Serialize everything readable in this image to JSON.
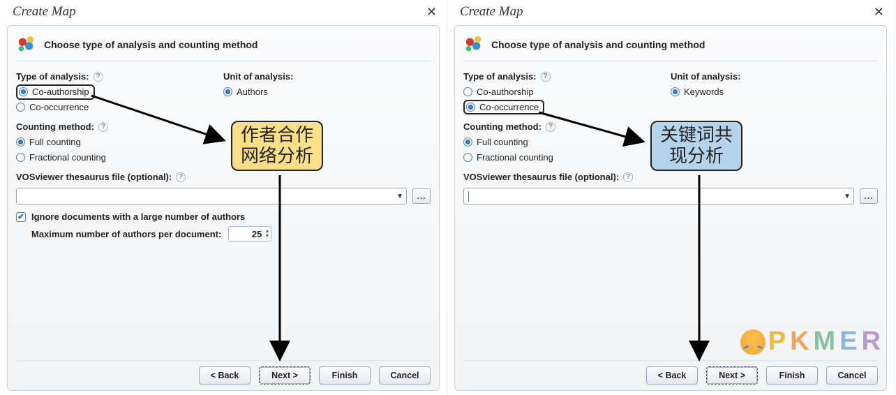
{
  "panels": [
    {
      "title": "Create Map",
      "heading": "Choose type of analysis and counting method",
      "labels": {
        "type_of_analysis": "Type of analysis:",
        "unit_of_analysis": "Unit of analysis:",
        "counting_method": "Counting method:",
        "thesaurus": "VOSviewer thesaurus file (optional):",
        "ignore_docs": "Ignore documents with a large number of authors",
        "max_authors": "Maximum number of authors per document:"
      },
      "type_radios": [
        {
          "label": "Co-authorship",
          "checked": true,
          "highlighted": true
        },
        {
          "label": "Co-occurrence",
          "checked": false,
          "highlighted": false
        }
      ],
      "unit_radios": [
        {
          "label": "Authors",
          "checked": true
        }
      ],
      "counting_radios": [
        {
          "label": "Full counting",
          "checked": true
        },
        {
          "label": "Fractional counting",
          "checked": false
        }
      ],
      "ignore_docs_checked": true,
      "max_authors_value": "25",
      "buttons": {
        "back": "< Back",
        "next": "Next >",
        "finish": "Finish",
        "cancel": "Cancel"
      },
      "annotation": {
        "text_line1": "作者合作",
        "text_line2": "网络分析",
        "color": "yellow"
      }
    },
    {
      "title": "Create Map",
      "heading": "Choose type of analysis and counting method",
      "labels": {
        "type_of_analysis": "Type of analysis:",
        "unit_of_analysis": "Unit of analysis:",
        "counting_method": "Counting method:",
        "thesaurus": "VOSviewer thesaurus file (optional):"
      },
      "type_radios": [
        {
          "label": "Co-authorship",
          "checked": false,
          "highlighted": false
        },
        {
          "label": "Co-occurrence",
          "checked": true,
          "highlighted": true
        }
      ],
      "unit_radios": [
        {
          "label": "Keywords",
          "checked": true
        }
      ],
      "counting_radios": [
        {
          "label": "Full counting",
          "checked": true
        },
        {
          "label": "Fractional counting",
          "checked": false
        }
      ],
      "buttons": {
        "back": "< Back",
        "next": "Next >",
        "finish": "Finish",
        "cancel": "Cancel"
      },
      "annotation": {
        "text_line1": "关键词共",
        "text_line2": "现分析",
        "color": "blue"
      }
    }
  ],
  "help_tip_glyph": "?",
  "browse_label": "...",
  "watermark": "PKMER"
}
